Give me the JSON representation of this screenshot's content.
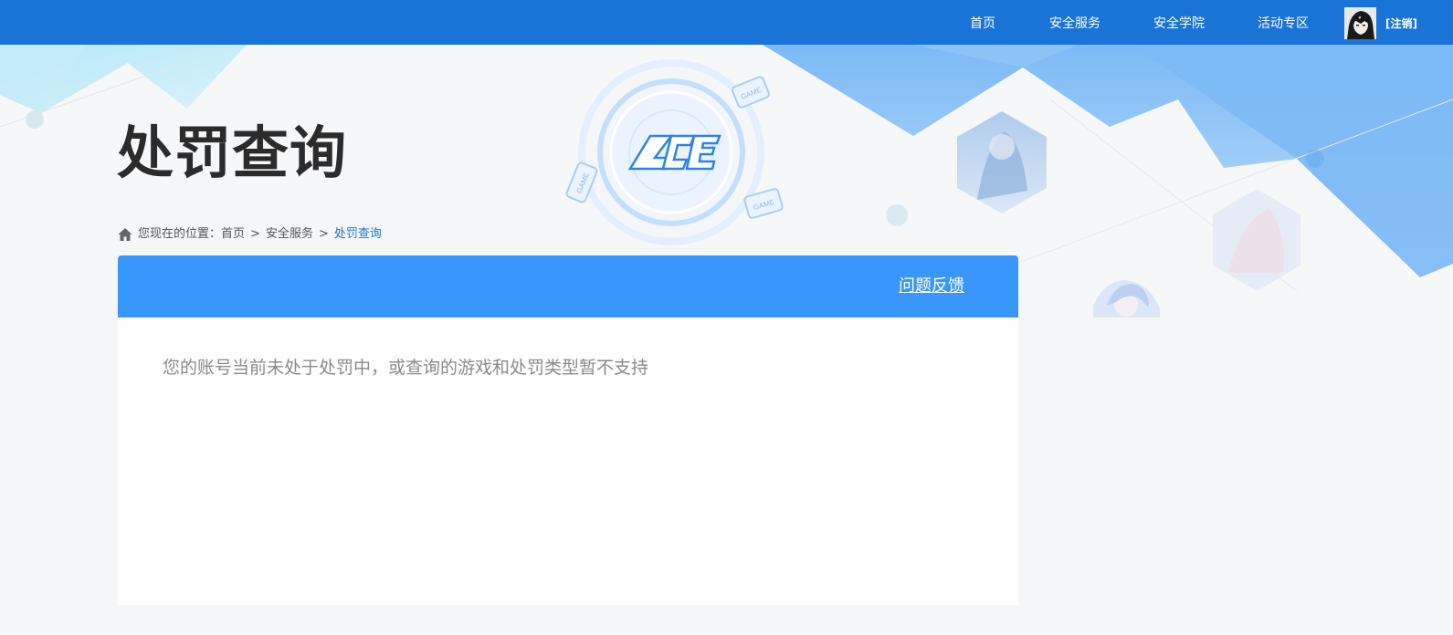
{
  "nav": {
    "items": [
      {
        "label": "首页"
      },
      {
        "label": "安全服务"
      },
      {
        "label": "安全学院"
      },
      {
        "label": "活动专区"
      }
    ],
    "logout_label": "[注销]"
  },
  "hero": {
    "title": "处罚查询",
    "logo_text": "ACE",
    "badge_text": "GAME"
  },
  "breadcrumb": {
    "prefix": "您现在的位置：",
    "items": [
      {
        "label": "首页"
      },
      {
        "label": "安全服务"
      }
    ],
    "separator": ">",
    "current": "处罚查询"
  },
  "card": {
    "feedback_label": "问题反馈",
    "message": "您的账号当前未处于处罚中，或查询的游戏和处罚类型暂不支持"
  },
  "colors": {
    "nav_bg": "#1a74d8",
    "card_header_bg": "#3896fc",
    "accent": "#1a74d8"
  },
  "icons": {
    "home": "home-icon",
    "avatar": "user-avatar",
    "logo": "ace-logo"
  }
}
